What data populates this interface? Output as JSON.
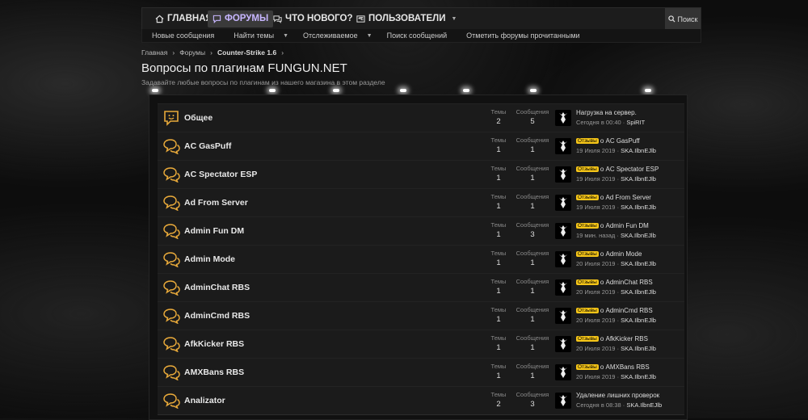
{
  "nav": {
    "tabs": [
      {
        "label": "ГЛАВНАЯ",
        "icon": "home-icon",
        "active": false
      },
      {
        "label": "ФОРУМЫ",
        "icon": "forum-icon",
        "active": true
      },
      {
        "label": "ЧТО НОВОГО?",
        "icon": "chat-icon",
        "active": false,
        "dropdown": true
      },
      {
        "label": "ПОЛЬЗОВАТЕЛИ",
        "icon": "users-icon",
        "active": false,
        "dropdown": true
      }
    ],
    "search_label": "Поиск"
  },
  "subnav": [
    {
      "label": "Новые сообщения",
      "dropdown": false
    },
    {
      "label": "Найти темы",
      "dropdown": true
    },
    {
      "label": "Отслеживаемое",
      "dropdown": true
    },
    {
      "label": "Поиск сообщений",
      "dropdown": false
    },
    {
      "label": "Отметить форумы прочитанными",
      "dropdown": false
    }
  ],
  "breadcrumb": [
    "Главная",
    "Форумы",
    "Counter-Strike 1.6"
  ],
  "page_title": "Вопросы по плагинам FUNGUN.NET",
  "page_description": "Задавайте любые вопросы по плагинам из нашего магазина в этом разделе",
  "labels": {
    "threads": "Темы",
    "messages": "Сообщения",
    "badge": "Отзывы"
  },
  "colors": {
    "accent": "#f5c518",
    "active_tab": "#c7b6ff",
    "icon": "#e8a93a"
  },
  "forums": [
    {
      "title": "Общее",
      "icon": "smiley-chat-icon",
      "threads": "2",
      "messages": "5",
      "badge": false,
      "last_title": "Нагрузка на сервер.",
      "last_date": "Сегодня в 00:40",
      "last_user": "SpiRIT"
    },
    {
      "title": "AC GasPuff",
      "icon": "chat-bubbles-icon",
      "threads": "1",
      "messages": "1",
      "badge": true,
      "last_title": "о AC GasPuff",
      "last_date": "19 Июля 2019",
      "last_user": "SKA.IlbnEJlb"
    },
    {
      "title": "AC Spectator ESP",
      "icon": "chat-bubbles-icon",
      "threads": "1",
      "messages": "1",
      "badge": true,
      "last_title": "о AC Spectator ESP",
      "last_date": "19 Июля 2019",
      "last_user": "SKA.IlbnEJlb"
    },
    {
      "title": "Ad From Server",
      "icon": "chat-bubbles-icon",
      "threads": "1",
      "messages": "1",
      "badge": true,
      "last_title": "о Ad From Server",
      "last_date": "19 Июля 2019",
      "last_user": "SKA.IlbnEJlb"
    },
    {
      "title": "Admin Fun DM",
      "icon": "chat-bubbles-icon",
      "threads": "1",
      "messages": "3",
      "badge": true,
      "last_title": "о Admin Fun DM",
      "last_date": "19 мин. назад",
      "last_user": "SKA.IlbnEJlb"
    },
    {
      "title": "Admin Mode",
      "icon": "chat-bubbles-icon",
      "threads": "1",
      "messages": "1",
      "badge": true,
      "last_title": "о Admin Mode",
      "last_date": "20 Июля 2019",
      "last_user": "SKA.IlbnEJlb"
    },
    {
      "title": "AdminChat RBS",
      "icon": "chat-bubbles-icon",
      "threads": "1",
      "messages": "1",
      "badge": true,
      "last_title": "о AdminChat RBS",
      "last_date": "20 Июля 2019",
      "last_user": "SKA.IlbnEJlb"
    },
    {
      "title": "AdminCmd RBS",
      "icon": "chat-bubbles-icon",
      "threads": "1",
      "messages": "1",
      "badge": true,
      "last_title": "о AdminCmd RBS",
      "last_date": "20 Июля 2019",
      "last_user": "SKA.IlbnEJlb"
    },
    {
      "title": "AfkKicker RBS",
      "icon": "chat-bubbles-icon",
      "threads": "1",
      "messages": "1",
      "badge": true,
      "last_title": "о AfkKicker RBS",
      "last_date": "20 Июля 2019",
      "last_user": "SKA.IlbnEJlb"
    },
    {
      "title": "AMXBans RBS",
      "icon": "chat-bubbles-icon",
      "threads": "1",
      "messages": "1",
      "badge": true,
      "last_title": "о AMXBans RBS",
      "last_date": "20 Июля 2019",
      "last_user": "SKA.IlbnEJlb"
    },
    {
      "title": "Analizator",
      "icon": "chat-bubbles-icon",
      "threads": "2",
      "messages": "3",
      "badge": false,
      "last_title": "Удаление лишних проверок",
      "last_date": "Сегодня в 08:38",
      "last_user": "SKA.IlbnEJlb"
    }
  ]
}
